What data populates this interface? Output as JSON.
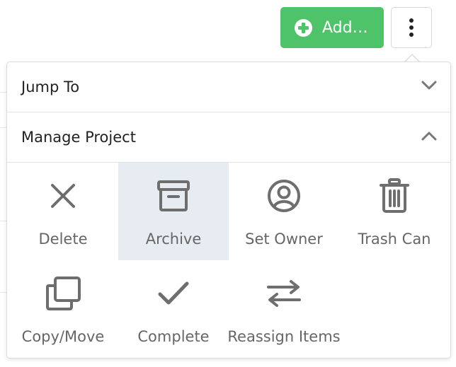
{
  "toolbar": {
    "add_label": "Add…",
    "add_icon": "plus-circle-icon",
    "more_icon": "vertical-ellipsis-icon",
    "accent_color": "#4fc36a"
  },
  "menu": {
    "sections": [
      {
        "label": "Jump To",
        "state": "collapsed",
        "chevron": "chevron-down-icon"
      },
      {
        "label": "Manage Project",
        "state": "expanded",
        "chevron": "chevron-up-icon"
      }
    ],
    "actions": [
      {
        "label": "Delete",
        "icon": "close-icon"
      },
      {
        "label": "Archive",
        "icon": "archive-box-icon",
        "highlighted": true
      },
      {
        "label": "Set Owner",
        "icon": "user-circle-icon"
      },
      {
        "label": "Trash Can",
        "icon": "trash-icon"
      },
      {
        "label": "Copy/Move",
        "icon": "copy-icon"
      },
      {
        "label": "Complete",
        "icon": "checkmark-icon"
      },
      {
        "label": "Reassign Items",
        "icon": "swap-arrows-icon"
      }
    ],
    "highlight_color": "#e7ebf2",
    "icon_color": "#6e6e6e"
  }
}
